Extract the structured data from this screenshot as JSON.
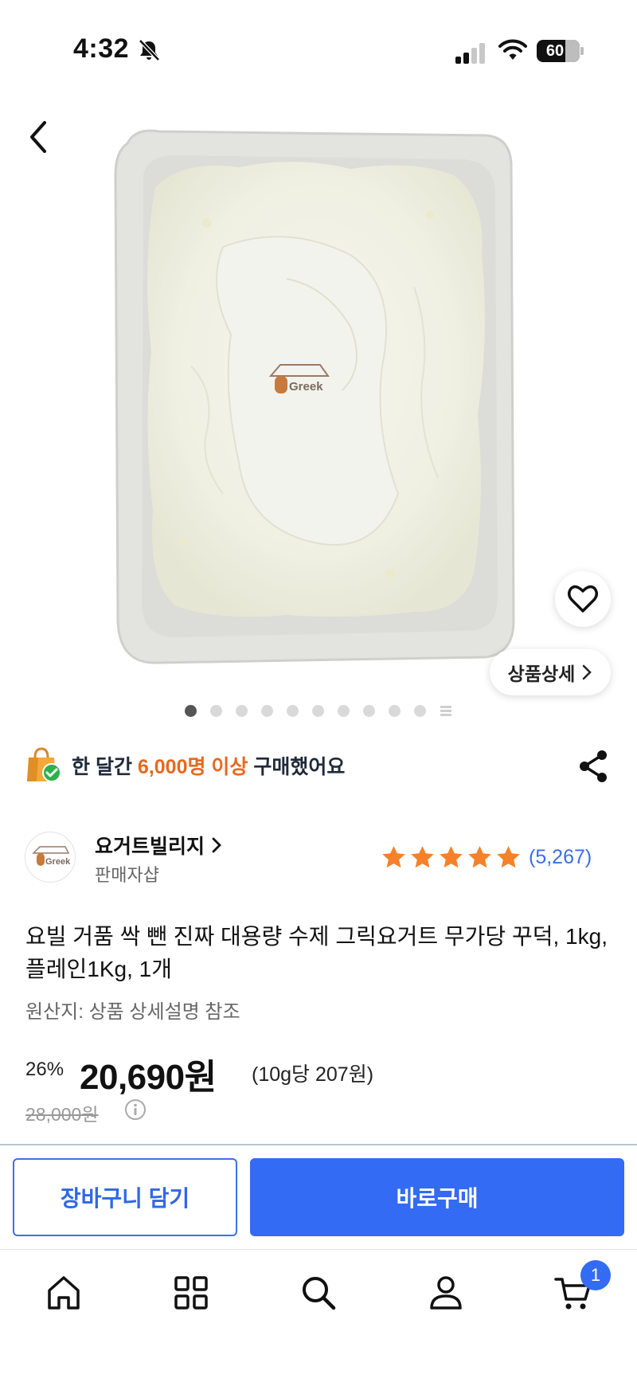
{
  "status_bar": {
    "time": "4:32",
    "battery": "60"
  },
  "product": {
    "image_logo_text": "Greek",
    "detail_button_label": "상품상세",
    "image_count": 11
  },
  "purchase_notice": {
    "prefix": "한 달간 ",
    "highlight": "6,000명 이상",
    "suffix": " 구매했어요"
  },
  "seller": {
    "name": "요거트빌리지",
    "type": "판매자샵",
    "logo_text": "Greek",
    "rating_stars": 5,
    "review_count": "(5,267)"
  },
  "title": "요빌 거품 싹 뺀 진짜 대용량 수제 그릭요거트 무가당 꾸덕, 1kg, 플레인1Kg, 1개",
  "origin": "원산지: 상품 상세설명 참조",
  "price": {
    "discount": "26%",
    "sale_price": "20,690원",
    "unit_price": "(10g당 207원)",
    "original_price": "28,000원"
  },
  "actions": {
    "add_to_cart": "장바구니 담기",
    "buy_now": "바로구매"
  },
  "tab_bar": {
    "cart_badge": "1"
  },
  "colors": {
    "accent_blue": "#346bf4",
    "highlight_orange": "#e8681f",
    "star_orange": "#f5822a"
  }
}
